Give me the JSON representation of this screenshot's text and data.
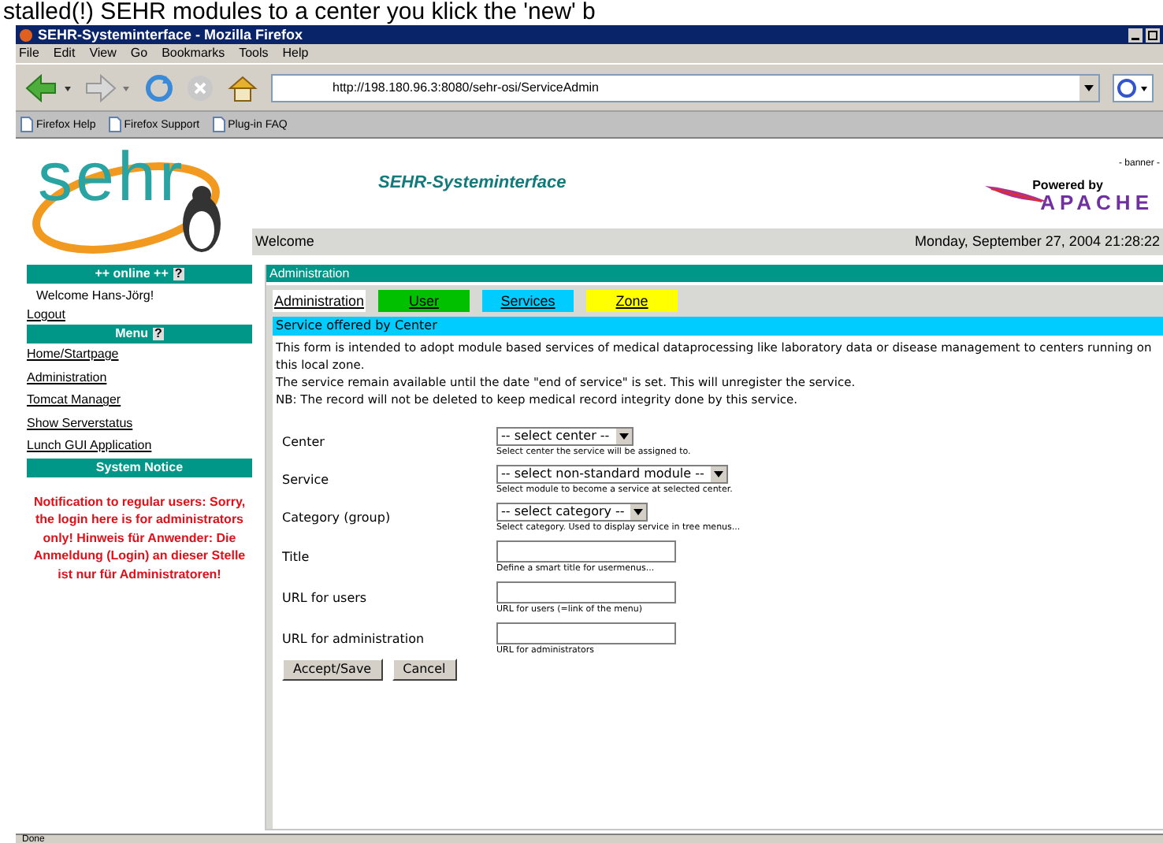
{
  "caption": "stalled(!) SEHR modules to a center you klick the 'new' b",
  "window": {
    "title": "SEHR-Systeminterface - Mozilla Firefox"
  },
  "menu": [
    "File",
    "Edit",
    "View",
    "Go",
    "Bookmarks",
    "Tools",
    "Help"
  ],
  "address": "http://198.180.96.3:8080/sehr-osi/ServiceAdmin",
  "bookmarks": [
    "Firefox Help",
    "Firefox Support",
    "Plug-in FAQ"
  ],
  "banner": {
    "logo": "sehr",
    "title": "SEHR-Systeminterface",
    "powered": "Powered by",
    "apache": "APACHE",
    "note": "- banner -",
    "welcome": "Welcome",
    "date": "Monday, September 27, 2004 21:28:22"
  },
  "sidebar": {
    "online_heading": "++ online ++",
    "help": "?",
    "greeting": "Welcome Hans-Jörg!",
    "logout": "Logout",
    "menu_heading": "Menu",
    "menu_help": "?",
    "items": [
      "Home/Startpage",
      "Administration",
      "Tomcat Manager",
      "Show Serverstatus",
      "Lunch GUI Application"
    ],
    "notice_heading": "System Notice",
    "notice": "Notification to regular users: Sorry, the login here is for administrators only! Hinweis für Anwender: Die Anmeldung (Login) an dieser Stelle ist nur für Administratoren!"
  },
  "section": "Administration",
  "tabs": [
    {
      "label": "Administration",
      "selected": true,
      "color": "#ffffff"
    },
    {
      "label": "User",
      "selected": false,
      "color": "#00c000"
    },
    {
      "label": "Services",
      "selected": false,
      "color": "#00ccff"
    },
    {
      "label": "Zone",
      "selected": false,
      "color": "#ffff00"
    }
  ],
  "form": {
    "heading": "Service offered by Center",
    "intro": [
      "This form is intended to adopt module based services of medical dataprocessing like laboratory data or disease management to centers running on this local zone.",
      "The service remain available until the date \"end of service\" is set. This will unregister the service.",
      "NB: The record will not be deleted to keep medical record integrity done by this service."
    ],
    "fields": [
      {
        "kind": "select",
        "label": "Center",
        "value": "-- select center --",
        "hint": "Select center the service will be assigned to."
      },
      {
        "kind": "select",
        "label": "Service",
        "value": "-- select non-standard module --",
        "hint": "Select module to become a service at selected center."
      },
      {
        "kind": "select",
        "label": "Category (group)",
        "value": "-- select category --",
        "hint": "Select category. Used to display service in tree menus..."
      },
      {
        "kind": "text",
        "label": "Title",
        "hint": "Define a smart title for usermenus..."
      },
      {
        "kind": "text",
        "label": "URL for users",
        "hint": "URL for users (=link of the menu)"
      },
      {
        "kind": "text",
        "label": "URL for administration",
        "hint": "URL for administrators"
      }
    ],
    "buttons": [
      "Accept/Save",
      "Cancel"
    ]
  },
  "status_bar": "Done"
}
